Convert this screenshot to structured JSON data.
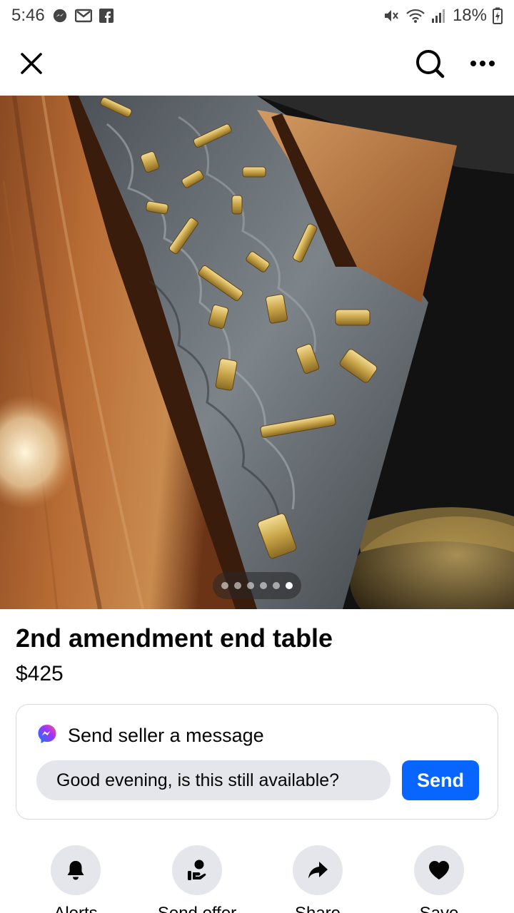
{
  "status_bar": {
    "time": "5:46",
    "battery": "18%",
    "left_icons": [
      "messenger-icon",
      "mail-icon",
      "facebook-icon"
    ],
    "right_icons": [
      "mute-icon",
      "wifi-icon",
      "signal-icon",
      "battery-charging-icon"
    ]
  },
  "nav": {
    "left_icon": "close-icon",
    "right_icons": [
      "search-icon",
      "more-icon"
    ]
  },
  "photo": {
    "dot_count": 6,
    "active_dot": 6
  },
  "listing": {
    "title": "2nd amendment end table",
    "price": "$425"
  },
  "message": {
    "header": "Send seller a message",
    "input_value": "Good evening, is this still available?",
    "send_label": "Send"
  },
  "actions": [
    {
      "label": "Alerts",
      "icon": "bell-icon"
    },
    {
      "label": "Send offer",
      "icon": "offer-icon"
    },
    {
      "label": "Share",
      "icon": "share-icon"
    },
    {
      "label": "Save",
      "icon": "heart-icon"
    }
  ],
  "colors": {
    "accent": "#0866ff",
    "chip_bg": "#e4e6eb",
    "border": "#d6d9dd"
  }
}
